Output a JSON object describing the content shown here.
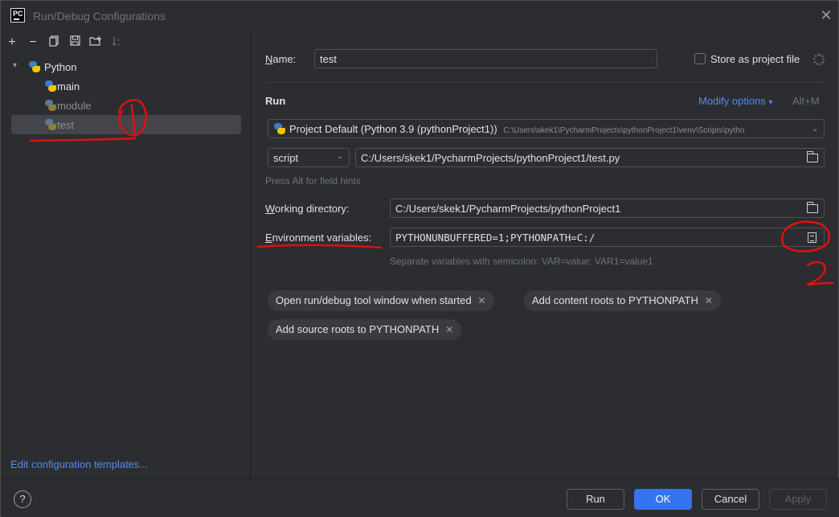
{
  "window": {
    "title": "Run/Debug Configurations",
    "logo_text": "PC"
  },
  "left": {
    "toolbar_icons": [
      "add-icon",
      "remove-icon",
      "copy-icon",
      "save-icon",
      "folder-add-icon",
      "sort-icon"
    ],
    "tree": {
      "group_label": "Python",
      "items": [
        {
          "label": "main"
        },
        {
          "label": "module"
        },
        {
          "label": "test"
        }
      ]
    },
    "edit_templates_link": "Edit configuration templates..."
  },
  "form": {
    "name_label": "Name:",
    "name_value": "test",
    "store_label": "Store as project file",
    "run_heading": "Run",
    "modify_options_label": "Modify options",
    "modify_options_shortcut": "Alt+M",
    "interpreter_main": "Project Default (Python 3.9 (pythonProject1))",
    "interpreter_path": "C:\\Users\\skek1\\PycharmProjects\\pythonProject1\\venv\\Scripts\\pytho",
    "target_type": "script",
    "script_path": "C:/Users/skek1/PycharmProjects/pythonProject1/test.py",
    "hint": "Press Alt for field hints",
    "working_dir_label": "Working directory:",
    "working_dir_value": "C:/Users/skek1/PycharmProjects/pythonProject1",
    "env_label": "Environment variables:",
    "env_value": "PYTHONUNBUFFERED=1;PYTHONPATH=C:/",
    "env_hint": "Separate variables with semicolon: VAR=value; VAR1=value1",
    "chips": [
      "Open run/debug tool window when started",
      "Add content roots to PYTHONPATH",
      "Add source roots to PYTHONPATH"
    ]
  },
  "buttons": {
    "help": "?",
    "run": "Run",
    "ok": "OK",
    "cancel": "Cancel",
    "apply": "Apply"
  },
  "annotations": {
    "color": "#e01010",
    "mark1": "1",
    "mark2": "2"
  }
}
